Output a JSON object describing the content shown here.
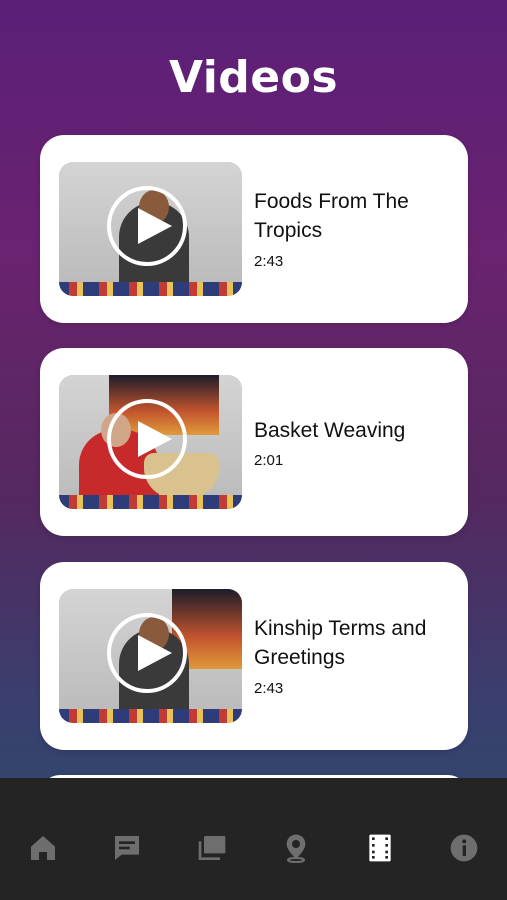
{
  "page": {
    "title": "Videos"
  },
  "videos": [
    {
      "title": "Foods From The Tropics",
      "duration": "2:43"
    },
    {
      "title": "Basket Weaving",
      "duration": "2:01"
    },
    {
      "title": "Kinship Terms and Greetings",
      "duration": "2:43"
    }
  ],
  "tab_bar": {
    "items": [
      {
        "icon": "home-icon",
        "active": false
      },
      {
        "icon": "chat-icon",
        "active": false
      },
      {
        "icon": "gallery-icon",
        "active": false
      },
      {
        "icon": "map-pin-icon",
        "active": false
      },
      {
        "icon": "film-icon",
        "active": true
      },
      {
        "icon": "info-icon",
        "active": false
      }
    ],
    "active_color": "#ffffff",
    "inactive_color": "#6e6e6e"
  }
}
